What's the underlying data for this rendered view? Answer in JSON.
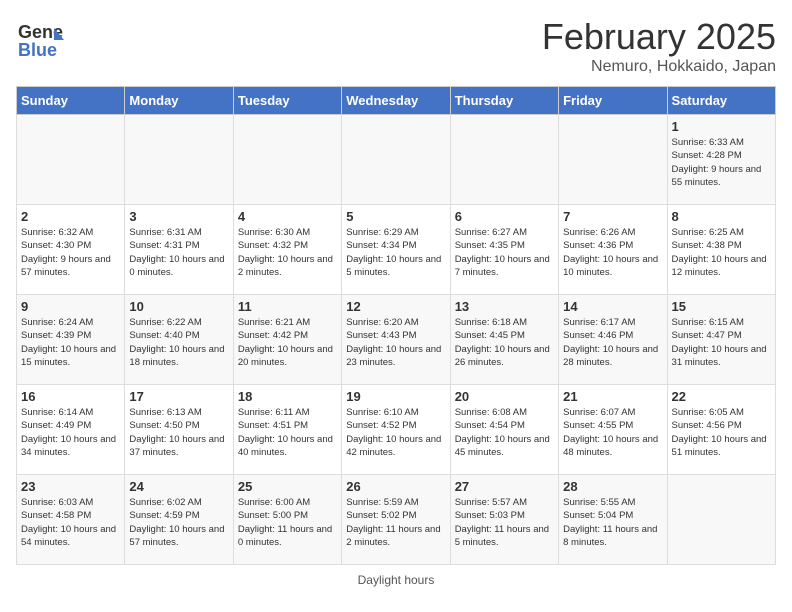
{
  "header": {
    "logo_general": "General",
    "logo_blue": "Blue",
    "title": "February 2025",
    "subtitle": "Nemuro, Hokkaido, Japan"
  },
  "days_of_week": [
    "Sunday",
    "Monday",
    "Tuesday",
    "Wednesday",
    "Thursday",
    "Friday",
    "Saturday"
  ],
  "weeks": [
    [
      {
        "day": "",
        "info": ""
      },
      {
        "day": "",
        "info": ""
      },
      {
        "day": "",
        "info": ""
      },
      {
        "day": "",
        "info": ""
      },
      {
        "day": "",
        "info": ""
      },
      {
        "day": "",
        "info": ""
      },
      {
        "day": "1",
        "info": "Sunrise: 6:33 AM\nSunset: 4:28 PM\nDaylight: 9 hours and 55 minutes."
      }
    ],
    [
      {
        "day": "2",
        "info": "Sunrise: 6:32 AM\nSunset: 4:30 PM\nDaylight: 9 hours and 57 minutes."
      },
      {
        "day": "3",
        "info": "Sunrise: 6:31 AM\nSunset: 4:31 PM\nDaylight: 10 hours and 0 minutes."
      },
      {
        "day": "4",
        "info": "Sunrise: 6:30 AM\nSunset: 4:32 PM\nDaylight: 10 hours and 2 minutes."
      },
      {
        "day": "5",
        "info": "Sunrise: 6:29 AM\nSunset: 4:34 PM\nDaylight: 10 hours and 5 minutes."
      },
      {
        "day": "6",
        "info": "Sunrise: 6:27 AM\nSunset: 4:35 PM\nDaylight: 10 hours and 7 minutes."
      },
      {
        "day": "7",
        "info": "Sunrise: 6:26 AM\nSunset: 4:36 PM\nDaylight: 10 hours and 10 minutes."
      },
      {
        "day": "8",
        "info": "Sunrise: 6:25 AM\nSunset: 4:38 PM\nDaylight: 10 hours and 12 minutes."
      }
    ],
    [
      {
        "day": "9",
        "info": "Sunrise: 6:24 AM\nSunset: 4:39 PM\nDaylight: 10 hours and 15 minutes."
      },
      {
        "day": "10",
        "info": "Sunrise: 6:22 AM\nSunset: 4:40 PM\nDaylight: 10 hours and 18 minutes."
      },
      {
        "day": "11",
        "info": "Sunrise: 6:21 AM\nSunset: 4:42 PM\nDaylight: 10 hours and 20 minutes."
      },
      {
        "day": "12",
        "info": "Sunrise: 6:20 AM\nSunset: 4:43 PM\nDaylight: 10 hours and 23 minutes."
      },
      {
        "day": "13",
        "info": "Sunrise: 6:18 AM\nSunset: 4:45 PM\nDaylight: 10 hours and 26 minutes."
      },
      {
        "day": "14",
        "info": "Sunrise: 6:17 AM\nSunset: 4:46 PM\nDaylight: 10 hours and 28 minutes."
      },
      {
        "day": "15",
        "info": "Sunrise: 6:15 AM\nSunset: 4:47 PM\nDaylight: 10 hours and 31 minutes."
      }
    ],
    [
      {
        "day": "16",
        "info": "Sunrise: 6:14 AM\nSunset: 4:49 PM\nDaylight: 10 hours and 34 minutes."
      },
      {
        "day": "17",
        "info": "Sunrise: 6:13 AM\nSunset: 4:50 PM\nDaylight: 10 hours and 37 minutes."
      },
      {
        "day": "18",
        "info": "Sunrise: 6:11 AM\nSunset: 4:51 PM\nDaylight: 10 hours and 40 minutes."
      },
      {
        "day": "19",
        "info": "Sunrise: 6:10 AM\nSunset: 4:52 PM\nDaylight: 10 hours and 42 minutes."
      },
      {
        "day": "20",
        "info": "Sunrise: 6:08 AM\nSunset: 4:54 PM\nDaylight: 10 hours and 45 minutes."
      },
      {
        "day": "21",
        "info": "Sunrise: 6:07 AM\nSunset: 4:55 PM\nDaylight: 10 hours and 48 minutes."
      },
      {
        "day": "22",
        "info": "Sunrise: 6:05 AM\nSunset: 4:56 PM\nDaylight: 10 hours and 51 minutes."
      }
    ],
    [
      {
        "day": "23",
        "info": "Sunrise: 6:03 AM\nSunset: 4:58 PM\nDaylight: 10 hours and 54 minutes."
      },
      {
        "day": "24",
        "info": "Sunrise: 6:02 AM\nSunset: 4:59 PM\nDaylight: 10 hours and 57 minutes."
      },
      {
        "day": "25",
        "info": "Sunrise: 6:00 AM\nSunset: 5:00 PM\nDaylight: 11 hours and 0 minutes."
      },
      {
        "day": "26",
        "info": "Sunrise: 5:59 AM\nSunset: 5:02 PM\nDaylight: 11 hours and 2 minutes."
      },
      {
        "day": "27",
        "info": "Sunrise: 5:57 AM\nSunset: 5:03 PM\nDaylight: 11 hours and 5 minutes."
      },
      {
        "day": "28",
        "info": "Sunrise: 5:55 AM\nSunset: 5:04 PM\nDaylight: 11 hours and 8 minutes."
      },
      {
        "day": "",
        "info": ""
      }
    ]
  ],
  "footer": "Daylight hours"
}
